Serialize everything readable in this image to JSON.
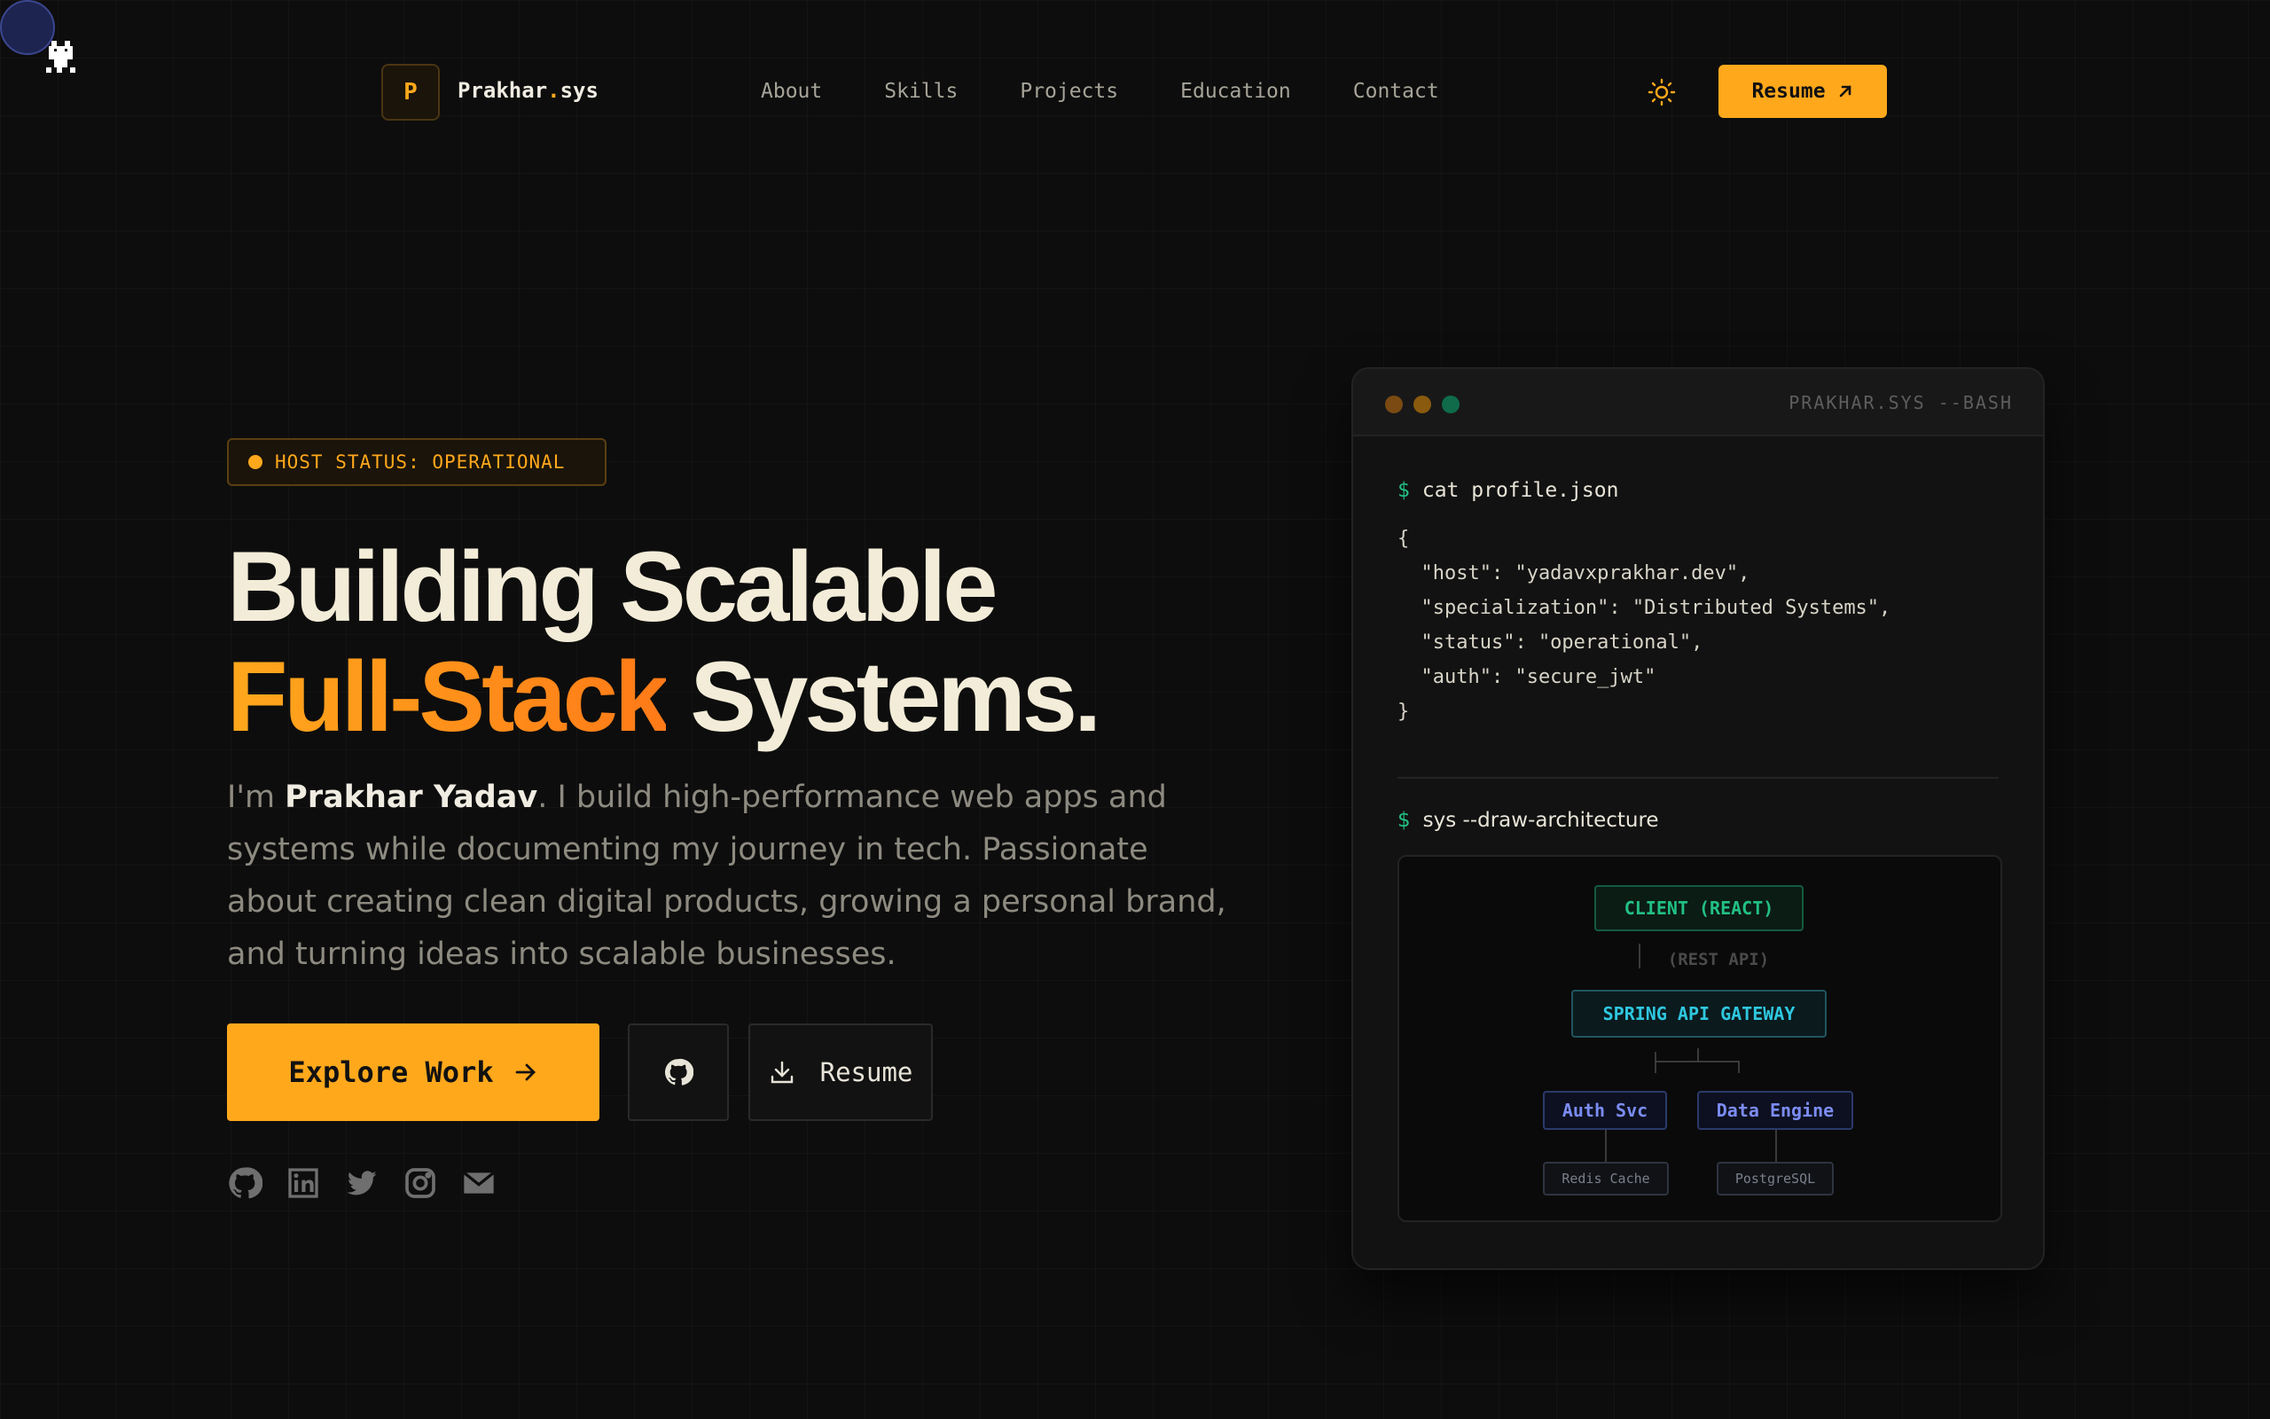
{
  "brand": {
    "logo_letter": "P",
    "name": "Prakhar",
    "dot": ".",
    "suffix": "sys"
  },
  "nav": {
    "links": [
      "About",
      "Skills",
      "Projects",
      "Education",
      "Contact"
    ],
    "resume_label": "Resume"
  },
  "hero": {
    "status": "HOST STATUS: OPERATIONAL",
    "headline_line1": "Building Scalable",
    "headline_accent": "Full-Stack",
    "headline_line2_rest": " Systems.",
    "intro_prefix": "I'm ",
    "intro_name": "Prakhar Yadav",
    "intro_rest": ". I build high-performance web apps and systems while documenting my journey in tech. Passionate about creating clean digital products, growing a personal brand, and turning ideas into scalable businesses.",
    "explore_label": "Explore Work",
    "download_label": "Resume"
  },
  "socials": [
    "github-icon",
    "linkedin-icon",
    "twitter-icon",
    "instagram-icon",
    "mail-icon"
  ],
  "terminal": {
    "title": "PRAKHAR.SYS --BASH",
    "prompt": "$",
    "cmd1": "cat profile.json",
    "json": "{\n  \"host\": \"yadavxprakhar.dev\",\n  \"specialization\": \"Distributed Systems\",\n  \"status\": \"operational\",\n  \"auth\": \"secure_jwt\"\n}",
    "cmd2": "sys --draw-architecture",
    "diagram": {
      "client": "CLIENT (REACT)",
      "rest": "(REST API)",
      "gateway": "SPRING API GATEWAY",
      "auth": "Auth Svc",
      "engine": "Data Engine",
      "redis": "Redis Cache",
      "postgres": "PostgreSQL"
    }
  },
  "colors": {
    "accent": "#ffa81c",
    "bg": "#0d0d0d",
    "green": "#22c084",
    "cyan": "#2ec7df",
    "indigo": "#7b8cf2"
  }
}
